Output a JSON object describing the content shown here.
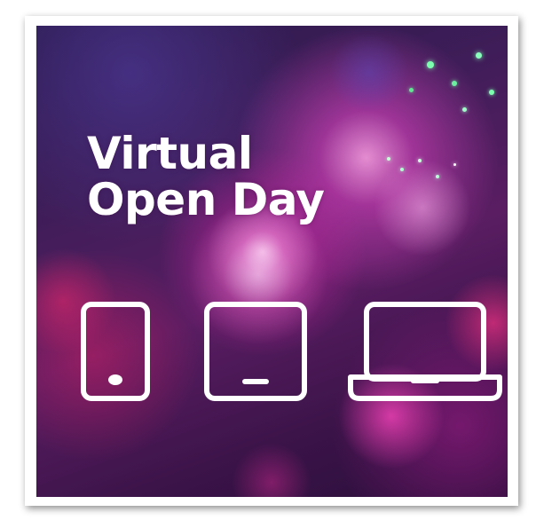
{
  "promo": {
    "headline_line1": "Virtual",
    "headline_line2": "Open Day"
  },
  "icons": [
    "phone-icon",
    "tablet-icon",
    "laptop-icon"
  ],
  "colors": {
    "background": "#3f1d58",
    "glow": "#e04fc8",
    "text": "#ffffff",
    "frame": "#ffffff"
  }
}
